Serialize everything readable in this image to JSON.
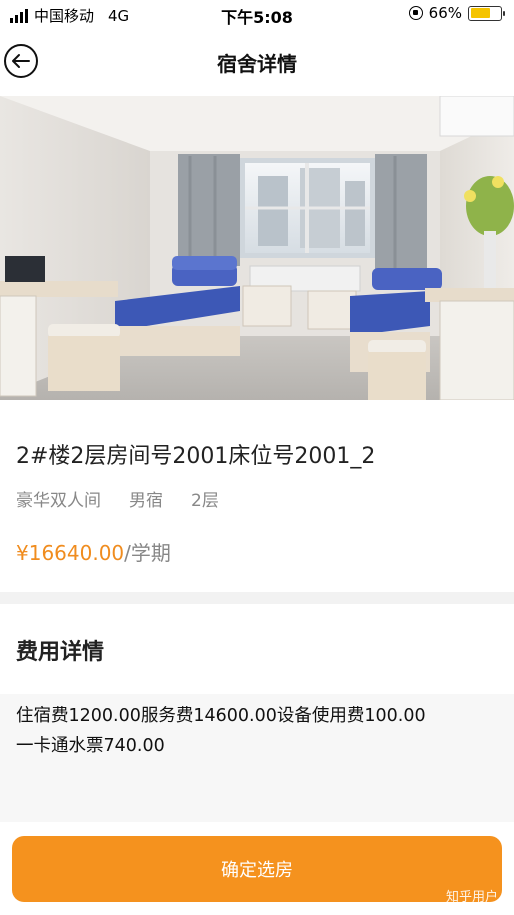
{
  "status_bar": {
    "carrier": "中国移动",
    "network": "4G",
    "time": "下午5:08",
    "battery": "66%",
    "battery_level": 0.66
  },
  "nav": {
    "title": "宿舍详情",
    "back_icon": "back-arrow-icon"
  },
  "room": {
    "title": "2#楼2层房间号2001床位号2001_2",
    "tags": [
      "豪华双人间",
      "男宿",
      "2层"
    ],
    "price": "¥16640.00",
    "price_unit": "/学期"
  },
  "fees": {
    "title": "费用详情",
    "line1": "住宿费1200.00服务费14600.00设备使用费100.00",
    "line2": "一卡通水票740.00"
  },
  "footer": {
    "confirm_label": "确定选房",
    "watermark": "知乎用户"
  },
  "colors": {
    "accent": "#f5921e",
    "price": "#f08c1e"
  }
}
